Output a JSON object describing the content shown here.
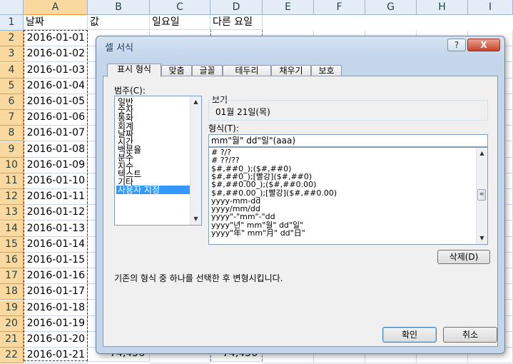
{
  "sheet": {
    "columns": [
      "A",
      "B",
      "C",
      "D",
      "E",
      "F",
      "G",
      "H",
      "I"
    ],
    "row_numbers": [
      "1",
      "2",
      "3",
      "4",
      "5",
      "6",
      "7",
      "8",
      "9",
      "10",
      "11",
      "12",
      "13",
      "14",
      "15",
      "16",
      "17",
      "18",
      "19",
      "20",
      "21",
      "22"
    ],
    "headers": {
      "A": "날짜",
      "B": "값",
      "C": "일요일",
      "D": "다른 요일"
    },
    "dates": [
      "2016-01-01",
      "2016-01-02",
      "2016-01-03",
      "2016-01-04",
      "2016-01-05",
      "2016-01-06",
      "2016-01-07",
      "2016-01-08",
      "2016-01-09",
      "2016-01-10",
      "2016-01-11",
      "2016-01-12",
      "2016-01-13",
      "2016-01-14",
      "2016-01-15",
      "2016-01-16",
      "2016-01-17",
      "2016-01-18",
      "2016-01-19",
      "2016-01-20",
      "2016-01-21"
    ],
    "last_row_values": {
      "B": "74,456",
      "D": "74,456"
    }
  },
  "dialog": {
    "title": "셀 서식",
    "help_label": "?",
    "close_label": "X",
    "tabs": [
      "표시 형식",
      "맞춤",
      "글꼴",
      "테두리",
      "채우기",
      "보호"
    ],
    "category_label": "범주(C):",
    "categories": [
      "일반",
      "숫자",
      "통화",
      "회계",
      "날짜",
      "시간",
      "백분율",
      "분수",
      "지수",
      "텍스트",
      "기타",
      "사용자 지정"
    ],
    "selected_category": "사용자 지정",
    "sample_label": "보기",
    "sample_value": "01월 21일(목)",
    "type_label": "형식(T):",
    "type_value": "mm\"월\" dd\"일\"(aaa)",
    "format_list": [
      "# ?/?",
      "# ??/??",
      "$#,##0_);($#,##0)",
      "$#,##0_);[빨강]($#,##0)",
      "$#,##0.00_);($#,##0.00)",
      "$#,##0.00_);[빨강]($#,##0.00)",
      "yyyy-mm-dd",
      "yyyy/mm/dd",
      "yyyy\"-\"mm\"-\"dd",
      "yyyy\"년\" mm\"월\" dd\"일\"",
      "yyyy\"年\" mm\"月\" dd\"日\""
    ],
    "delete_label": "삭제(D)",
    "hint": "기존의 형식 중 하나를 선택한 후 변형시킵니다.",
    "ok_label": "확인",
    "cancel_label": "취소"
  },
  "colors": {
    "selected_header": "#f9d99f",
    "selection_blue": "#3399ff",
    "dialog_bg": "#c4d6ec"
  }
}
